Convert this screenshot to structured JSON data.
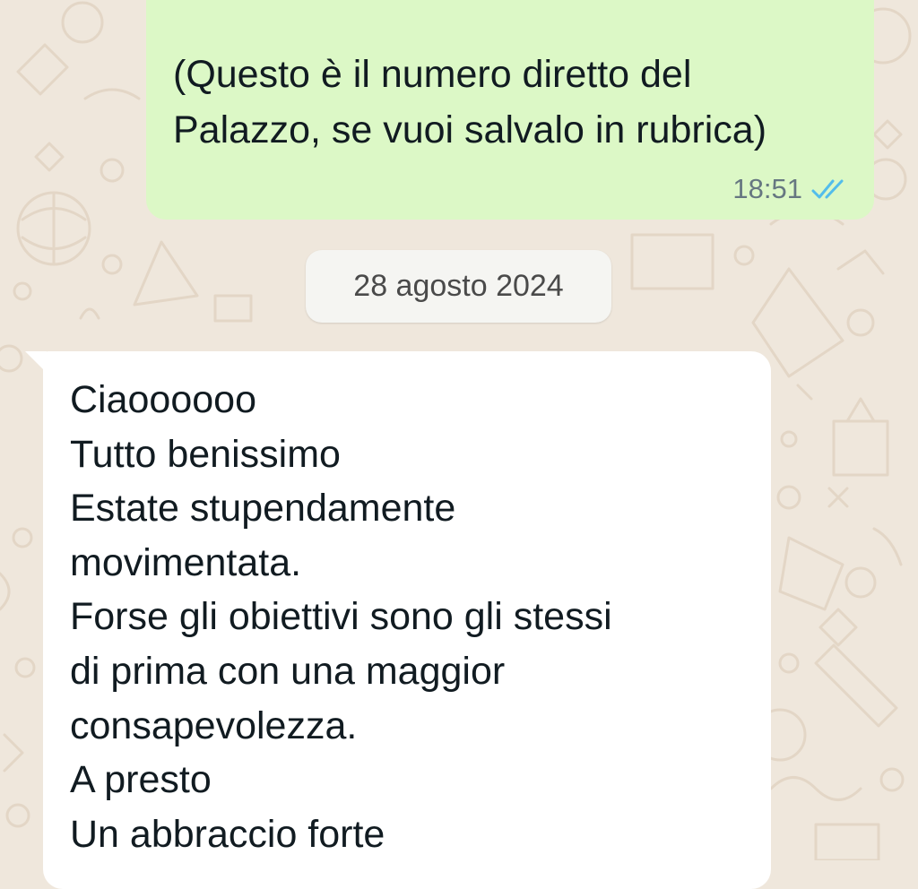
{
  "chat": {
    "outgoing_message": {
      "text": "(Questo è il numero diretto del Palazzo, se vuoi salvalo in rubrica)",
      "time": "18:51",
      "status_icon": "double-check-read-icon",
      "tick_color": "#53bdeb"
    },
    "date_separator": "28 agosto 2024",
    "incoming_message": {
      "lines": [
        "Ciaoooooo",
        "Tutto benissimo",
        "Estate stupendamente",
        "movimentata.",
        "Forse gli obiettivi sono gli stessi",
        "di prima con una maggior",
        "consapevolezza.",
        "A presto",
        "Un abbraccio forte"
      ]
    }
  },
  "colors": {
    "wallpaper": "#efe7dc",
    "outgoing_bubble": "#dcf8c6",
    "incoming_bubble": "#ffffff",
    "date_chip": "#f5f5f2"
  }
}
